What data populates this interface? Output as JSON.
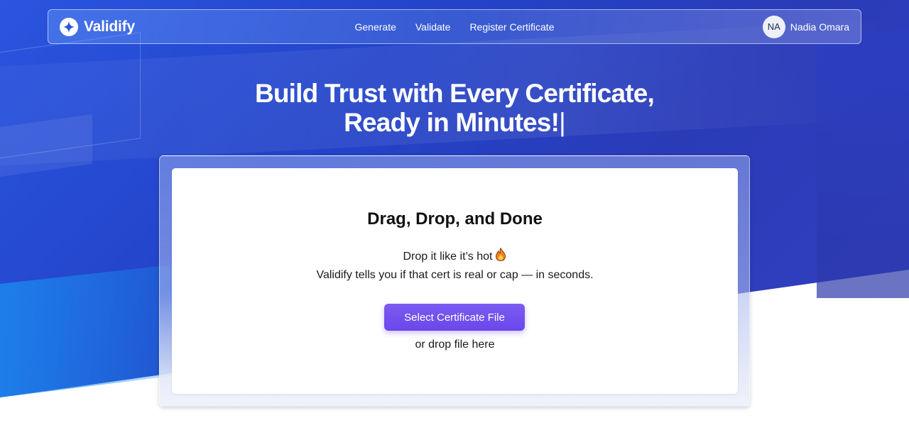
{
  "brand": {
    "name": "Validify",
    "icon": "sparkle-star-icon"
  },
  "nav": {
    "links": [
      {
        "label": "Generate"
      },
      {
        "label": "Validate"
      },
      {
        "label": "Register Certificate"
      }
    ]
  },
  "user": {
    "initials": "NA",
    "name": "Nadia Omara"
  },
  "hero": {
    "line1": "Build Trust with Every Certificate,",
    "line2": "Ready in Minutes!",
    "cursor": "|"
  },
  "upload": {
    "title": "Drag, Drop, and Done",
    "subtitle_line1": "Drop it like it’s hot",
    "subtitle_icon": "fire-icon",
    "subtitle_line2": "Validify tells you if that cert is real or cap — in seconds.",
    "button_label": "Select Certificate File",
    "drop_hint": "or drop file here"
  },
  "colors": {
    "hero_blue": "#2343c8",
    "button_purple": "#6a47ea"
  }
}
